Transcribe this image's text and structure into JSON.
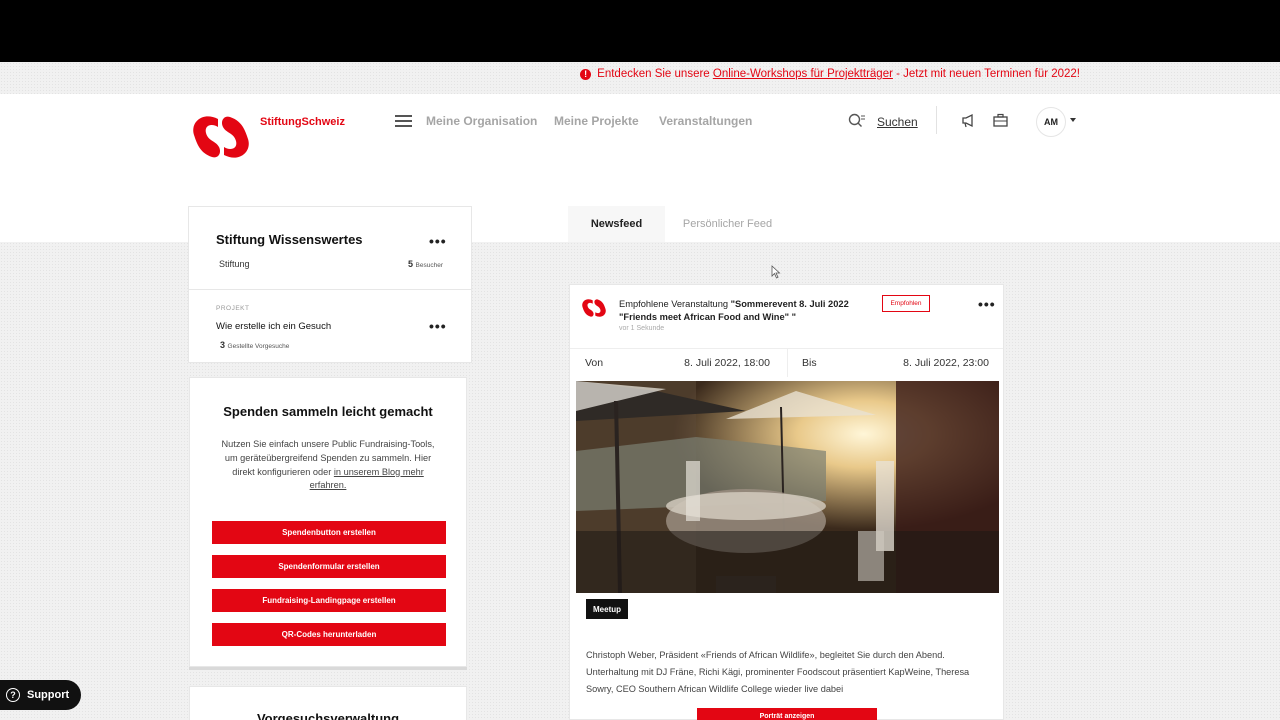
{
  "notice": {
    "prefix": "Entdecken Sie unsere ",
    "link": "Online-Workshops für Projektträger",
    "suffix": " - Jetzt mit neuen Terminen für 2022!"
  },
  "header": {
    "brand": "StiftungSchweiz",
    "nav": [
      "Meine Organisation",
      "Meine Projekte",
      "Veranstaltungen"
    ],
    "search_label": "Suchen",
    "avatar_initials": "AM"
  },
  "org_card": {
    "title": "Stiftung Wissenswertes",
    "type": "Stiftung",
    "visitors_count": "5",
    "visitors_label": "Besucher",
    "project_kicker": "PROJEKT",
    "project_title": "Wie erstelle ich ein Gesuch",
    "requests_count": "3",
    "requests_label": "Gestellte Vorgesuche"
  },
  "fundraising_card": {
    "title": "Spenden sammeln leicht gemacht",
    "text_1": "Nutzen Sie einfach unsere Public Fundraising-Tools,",
    "text_2": "um geräteübergreifend Spenden zu sammeln. Hier",
    "text_3": "direkt konfigurieren oder ",
    "text_link_a": "in unserem Blog mehr",
    "text_link_b": "erfahren.",
    "buttons": [
      "Spendenbutton erstellen",
      "Spendenformular erstellen",
      "Fundraising-Landingpage erstellen",
      "QR-Codes herunterladen"
    ]
  },
  "vorgesuch_card": {
    "title": "Vorgesuchsverwaltung"
  },
  "tabs": [
    "Newsfeed",
    "Persönlicher Feed"
  ],
  "feed_post": {
    "heading_prefix": "Empfohlene Veranstaltung ",
    "heading_bold_1": "\"Sommerevent 8. Juli 2022",
    "heading_bold_2": "\"Friends meet African Food and Wine\" \"",
    "time": "vor 1 Sekunde",
    "badge": "Empfohlen",
    "from_label": "Von",
    "from_value": "8. Juli 2022, 18:00",
    "to_label": "Bis",
    "to_value": "8. Juli 2022, 23:00",
    "tag": "Meetup",
    "description": "Christoph Weber, Präsident «Friends of African Wildlife», begleitet Sie durch den Abend. Unterhaltung mit DJ Fräne, Richi Kägi, prominenter Foodscout präsentiert KapWeine, Theresa Sowry, CEO Southern African Wildlife College wieder live dabei",
    "button": "Porträt anzeigen"
  },
  "support": {
    "label": "Support"
  },
  "colors": {
    "brand_red": "#e30613",
    "topbar": "#000000"
  }
}
